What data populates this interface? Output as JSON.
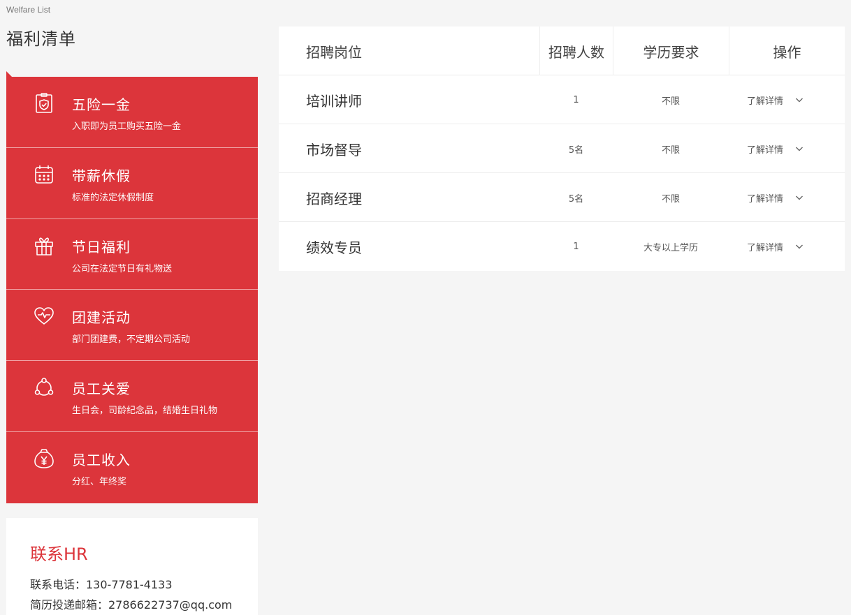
{
  "header": {
    "title_en": "Welfare List",
    "title_cn": "福利清单"
  },
  "benefits": [
    {
      "icon": "shield-check-icon",
      "title": "五险一金",
      "desc": "入职即为员工购买五险一金"
    },
    {
      "icon": "calendar-icon",
      "title": "带薪休假",
      "desc": "标准的法定休假制度"
    },
    {
      "icon": "gift-icon",
      "title": "节日福利",
      "desc": "公司在法定节日有礼物送"
    },
    {
      "icon": "heart-icon",
      "title": "团建活动",
      "desc": "部门团建费，不定期公司活动"
    },
    {
      "icon": "people-circle-icon",
      "title": "员工关爱",
      "desc": "生日会，司龄纪念品，结婚生日礼物"
    },
    {
      "icon": "yen-bag-icon",
      "title": "员工收入",
      "desc": "分红、年终奖"
    }
  ],
  "contact": {
    "title": "联系HR",
    "phone": "联系电话：130-7781-4133",
    "email": "简历投递邮箱：2786622737@qq.com"
  },
  "jobs": {
    "headers": {
      "position": "招聘岗位",
      "count": "招聘人数",
      "education": "学历要求",
      "action": "操作"
    },
    "rows": [
      {
        "position": "培训讲师",
        "count": "1",
        "education": "不限",
        "action": "了解详情"
      },
      {
        "position": "市场督导",
        "count": "5名",
        "education": "不限",
        "action": "了解详情"
      },
      {
        "position": "招商经理",
        "count": "5名",
        "education": "不限",
        "action": "了解详情"
      },
      {
        "position": "绩效专员",
        "count": "1",
        "education": "大专以上学历",
        "action": "了解详情"
      }
    ]
  },
  "colors": {
    "accent": "#dc353b",
    "background": "#f5f5f5"
  }
}
